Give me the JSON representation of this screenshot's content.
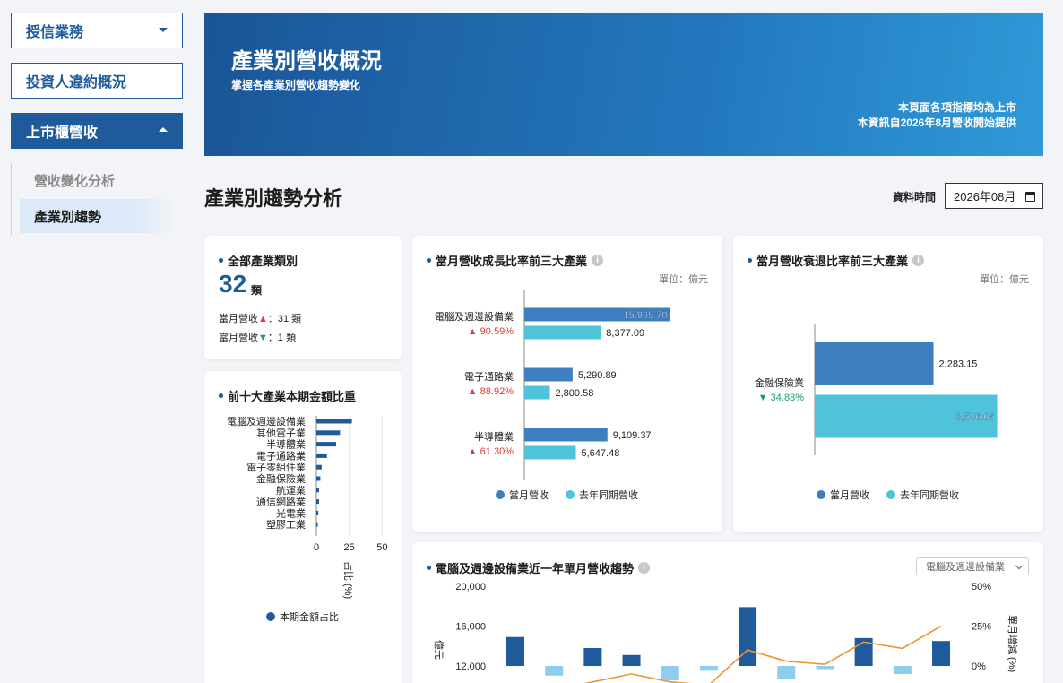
{
  "sidebar": {
    "items": [
      {
        "label": "授信業務"
      },
      {
        "label": "投資人違約概況"
      },
      {
        "label": "上市櫃營收"
      }
    ],
    "subitems": [
      {
        "label": "營收變化分析"
      },
      {
        "label": "產業別趨勢"
      }
    ]
  },
  "banner": {
    "title": "產業別營收概況",
    "subtitle": "掌握各產業別營收趨勢變化",
    "note_line1": "本頁面各項指標均為上市",
    "note_line2": "本資訊自2026年8月營收開始提供"
  },
  "section": {
    "title": "產業別趨勢分析",
    "date_label": "資料時間",
    "date_value": "2026年08月"
  },
  "summary": {
    "title": "全部產業類別",
    "count": "32",
    "count_unit": "類",
    "up_label": "當月營收",
    "up_value": "：31 類",
    "down_label": "當月營收",
    "down_value": "：1 類",
    "up_arrow": "▲",
    "down_arrow": "▼"
  },
  "colors": {
    "primary": "#1f5a9a",
    "bar_current": "#3f7fbf",
    "bar_last": "#4ec3d9",
    "up": "#e53935",
    "down": "#1e9e6a"
  },
  "chart_data": [
    {
      "id": "top10",
      "type": "bar",
      "orientation": "horizontal",
      "title": "前十大產業本期金額比重",
      "categories": [
        "電腦及週邊設備業",
        "其他電子業",
        "半導體業",
        "電子通路業",
        "電子零組件業",
        "金融保險業",
        "航運業",
        "通信網路業",
        "光電業",
        "塑膠工業"
      ],
      "values": [
        27,
        18,
        15,
        8,
        4,
        3,
        2,
        2,
        1.5,
        1
      ],
      "xticks": [
        "0",
        "25",
        "50"
      ],
      "xlim": [
        0,
        60
      ],
      "xlabel": "占比 (%)",
      "legend": "本期金額占比"
    },
    {
      "id": "growth",
      "type": "bar",
      "orientation": "horizontal",
      "title": "當月營收成長比率前三大產業",
      "unit": "單位：億元",
      "categories": [
        "電腦及週邊設備業",
        "電子通路業",
        "半導體業"
      ],
      "rates": [
        "▲ 90.59%",
        "▲ 88.92%",
        "▲ 61.30%"
      ],
      "series": [
        {
          "name": "當月營收",
          "values": [
            15965.7,
            5290.89,
            9109.37
          ],
          "labels": [
            "15,965.70",
            "5,290.89",
            "9,109.37"
          ]
        },
        {
          "name": "去年同期營收",
          "values": [
            8377.09,
            2800.58,
            5647.48
          ],
          "labels": [
            "8,377.09",
            "2,800.58",
            "5,647.48"
          ]
        }
      ],
      "xlim": [
        0,
        16500
      ]
    },
    {
      "id": "decline",
      "type": "bar",
      "orientation": "horizontal",
      "title": "當月營收衰退比率前三大產業",
      "unit": "單位：億元",
      "categories": [
        "金融保險業"
      ],
      "rates": [
        "▼ 34.88%"
      ],
      "series": [
        {
          "name": "當月營收",
          "values": [
            2283.15
          ],
          "labels": [
            "2,283.15"
          ]
        },
        {
          "name": "去年同期營收",
          "values": [
            3506.06
          ],
          "labels": [
            "3,506.06"
          ]
        }
      ],
      "xlim": [
        0,
        3600
      ]
    },
    {
      "id": "trend",
      "type": "bar",
      "title": "電腦及週邊設備業近一年單月營收趨勢",
      "y_left_ticks": [
        "20,000",
        "16,000",
        "12,000"
      ],
      "y_left_label": "億元",
      "y_left_lim": [
        12000,
        20000
      ],
      "y_right_ticks": [
        "50%",
        "25%",
        "0%"
      ],
      "y_right_label": "單月增減 (%)",
      "y_right_lim": [
        0,
        50
      ],
      "bars": [
        14900,
        null,
        13800,
        13100,
        null,
        null,
        17900,
        null,
        null,
        14800,
        null,
        14500
      ],
      "change_bars": [
        null,
        -6,
        null,
        null,
        -9,
        -3,
        null,
        -8,
        -2,
        null,
        -5,
        null
      ],
      "line": [
        -12,
        -15,
        -10,
        -5,
        -10,
        -12,
        10,
        3,
        1,
        15,
        11,
        25
      ]
    }
  ],
  "select": {
    "value": "電腦及週邊設備業"
  }
}
